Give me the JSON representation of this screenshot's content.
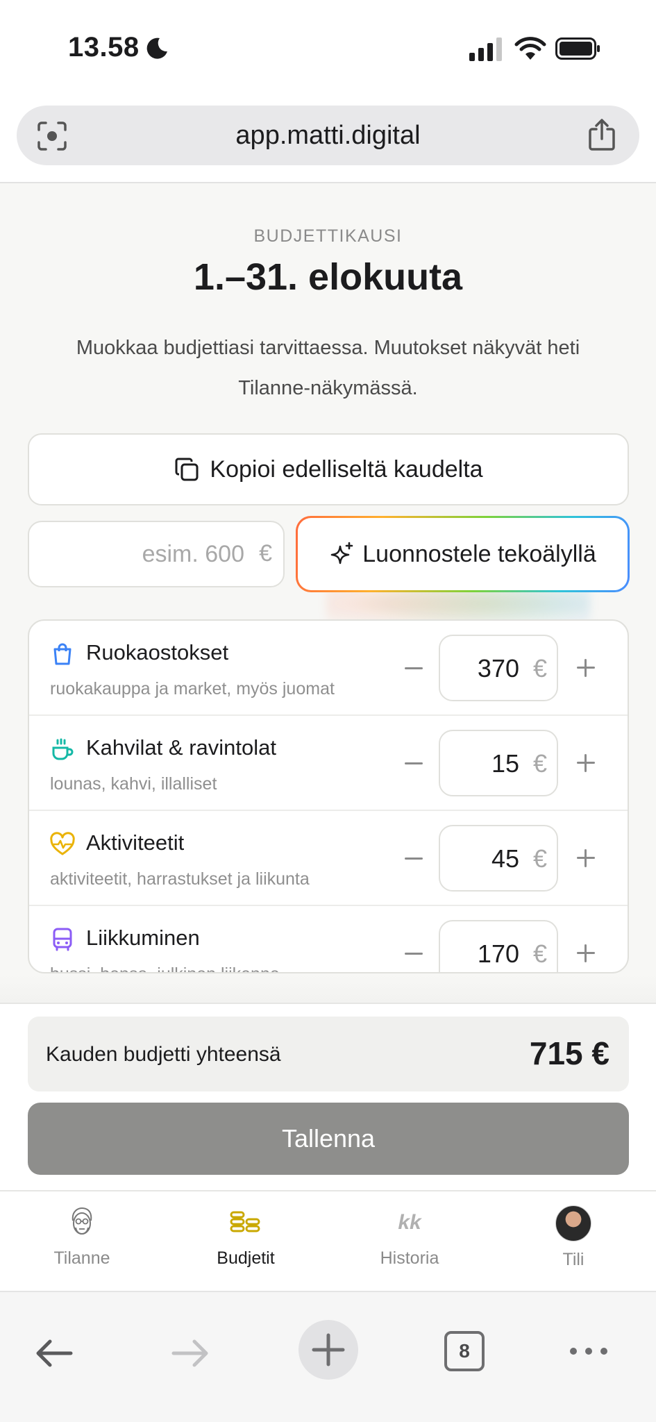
{
  "status_bar": {
    "time": "13.58"
  },
  "browser": {
    "url": "app.matti.digital",
    "tab_count": "8"
  },
  "header": {
    "kicker": "BUDJETTIKAUSI",
    "title": "1.–31. elokuuta",
    "description": "Muokkaa budjettiasi tarvittaessa. Muutokset näkyvät heti Tilanne-näkymässä."
  },
  "actions": {
    "copy_label": "Kopioi edelliseltä kaudelta",
    "amount_placeholder": "esim. 600",
    "currency": "€",
    "ai_label": "Luonnostele tekoälyllä"
  },
  "categories": [
    {
      "name": "Ruokaostokset",
      "sub": "ruokakauppa ja market, myös juomat",
      "value": "370",
      "icon": "shopping-bag-icon",
      "color": "#3b82f6"
    },
    {
      "name": "Kahvilat & ravintolat",
      "sub": "lounas, kahvi, illalliset",
      "value": "15",
      "icon": "coffee-cup-icon",
      "color": "#14b8a6"
    },
    {
      "name": "Aktiviteetit",
      "sub": "aktiviteetit, harrastukset ja liikunta",
      "value": "45",
      "icon": "heart-pulse-icon",
      "color": "#eab308"
    },
    {
      "name": "Liikkuminen",
      "sub": "bussi, bensa, julkinen liikenne",
      "value": "170",
      "icon": "bus-icon",
      "color": "#8b5cf6"
    }
  ],
  "footer": {
    "total_label": "Kauden budjetti yhteensä",
    "total_amount": "715 €",
    "save_label": "Tallenna"
  },
  "tabs": [
    {
      "label": "Tilanne",
      "icon": "face-sketch-icon",
      "active": false
    },
    {
      "label": "Budjetit",
      "icon": "coin-stacks-icon",
      "active": true
    },
    {
      "label": "Historia",
      "icon": "kk-icon",
      "glyph": "kk",
      "active": false
    },
    {
      "label": "Tili",
      "icon": "avatar",
      "active": false
    }
  ],
  "colors": {
    "accent_gold": "#c9a800",
    "save_button": "#8e8e8c"
  }
}
